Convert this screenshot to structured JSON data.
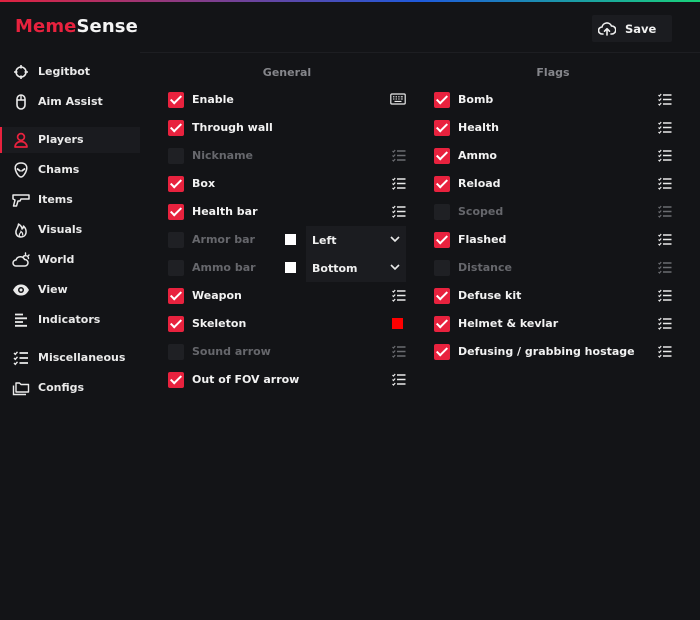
{
  "logo": {
    "part1": "Meme",
    "part2": "Sense"
  },
  "save": {
    "label": "Save",
    "icon": "cloud-upload-icon"
  },
  "sidebar": {
    "items": [
      {
        "label": "Legitbot",
        "icon": "crosshair-icon"
      },
      {
        "label": "Aim Assist",
        "icon": "mouse-icon"
      },
      {
        "label": "Players",
        "icon": "user-icon",
        "active": true
      },
      {
        "label": "Chams",
        "icon": "alien-head-icon"
      },
      {
        "label": "Items",
        "icon": "gun-icon"
      },
      {
        "label": "Visuals",
        "icon": "flame-icon"
      },
      {
        "label": "World",
        "icon": "cloud-sun-icon"
      },
      {
        "label": "View",
        "icon": "eye-icon"
      },
      {
        "label": "Indicators",
        "icon": "align-left-icon"
      },
      {
        "label": "Miscellaneous",
        "icon": "list-check-icon"
      },
      {
        "label": "Configs",
        "icon": "folders-icon"
      }
    ]
  },
  "general": {
    "title": "General",
    "items": [
      {
        "label": "Enable",
        "checked": true,
        "extra": "keybind"
      },
      {
        "label": "Through wall",
        "checked": true
      },
      {
        "label": "Nickname",
        "checked": false,
        "extra": "options"
      },
      {
        "label": "Box",
        "checked": true,
        "extra": "options"
      },
      {
        "label": "Health bar",
        "checked": true,
        "extra": "options"
      },
      {
        "label": "Armor bar",
        "checked": false,
        "color": "#ffffff",
        "dropdown": "Left"
      },
      {
        "label": "Ammo bar",
        "checked": false,
        "color": "#ffffff",
        "dropdown": "Bottom"
      },
      {
        "label": "Weapon",
        "checked": true,
        "extra": "options"
      },
      {
        "label": "Skeleton",
        "checked": true,
        "color": "#ff0000"
      },
      {
        "label": "Sound arrow",
        "checked": false,
        "extra": "options"
      },
      {
        "label": "Out of FOV arrow",
        "checked": true,
        "extra": "options"
      }
    ]
  },
  "flags": {
    "title": "Flags",
    "items": [
      {
        "label": "Bomb",
        "checked": true
      },
      {
        "label": "Health",
        "checked": true
      },
      {
        "label": "Ammo",
        "checked": true
      },
      {
        "label": "Reload",
        "checked": true
      },
      {
        "label": "Scoped",
        "checked": false
      },
      {
        "label": "Flashed",
        "checked": true
      },
      {
        "label": "Distance",
        "checked": false
      },
      {
        "label": "Defuse kit",
        "checked": true
      },
      {
        "label": "Helmet & kevlar",
        "checked": true
      },
      {
        "label": "Defusing / grabbing hostage",
        "checked": true
      }
    ]
  },
  "colors": {
    "accent": "#e8223e",
    "background": "#131417",
    "panel": "#1b1c20",
    "dim_text": "#66676c"
  }
}
